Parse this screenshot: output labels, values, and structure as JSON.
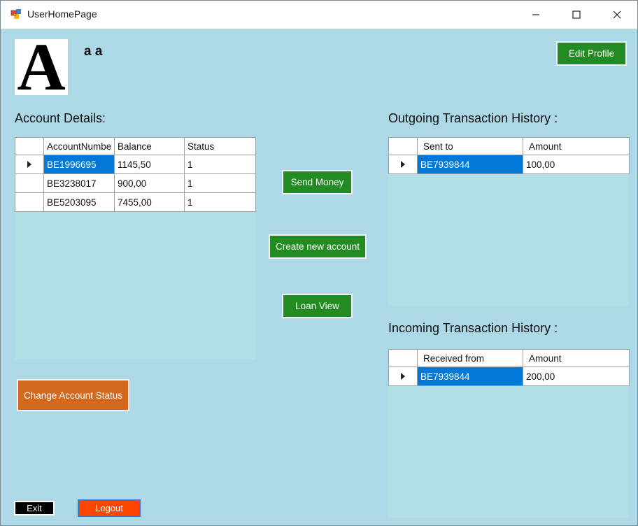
{
  "window": {
    "title": "UserHomePage"
  },
  "header": {
    "avatar_letter": "A",
    "username": "a a",
    "edit_profile_label": "Edit Profile"
  },
  "account_details": {
    "label": "Account Details:",
    "columns": [
      "AccountNumbe",
      "Balance",
      "Status"
    ],
    "rows": [
      [
        "BE1996695",
        "1145,50",
        "1"
      ],
      [
        "BE3238017",
        "900,00",
        "1"
      ],
      [
        "BE5203095",
        "7455,00",
        "1"
      ]
    ]
  },
  "actions": {
    "send_money": "Send Money",
    "create_account": "Create new account",
    "loan_view": "Loan View",
    "change_status": "Change Account Status"
  },
  "outgoing": {
    "label": "Outgoing Transaction History :",
    "columns": [
      "Sent to",
      "Amount"
    ],
    "rows": [
      [
        "BE7939844",
        "100,00"
      ]
    ]
  },
  "incoming": {
    "label": "Incoming Transaction History :",
    "columns": [
      "Received from",
      "Amount"
    ],
    "rows": [
      [
        "BE7939844",
        "200,00"
      ]
    ]
  },
  "footer": {
    "exit_label": "Exit",
    "logout_label": "Logout"
  },
  "colors": {
    "background": "#add8e6",
    "grid_background": "#b0e0e6",
    "button_green": "#228b22",
    "button_orange": "#d2691e",
    "button_red": "#ff4500",
    "selection": "#0078d7"
  }
}
